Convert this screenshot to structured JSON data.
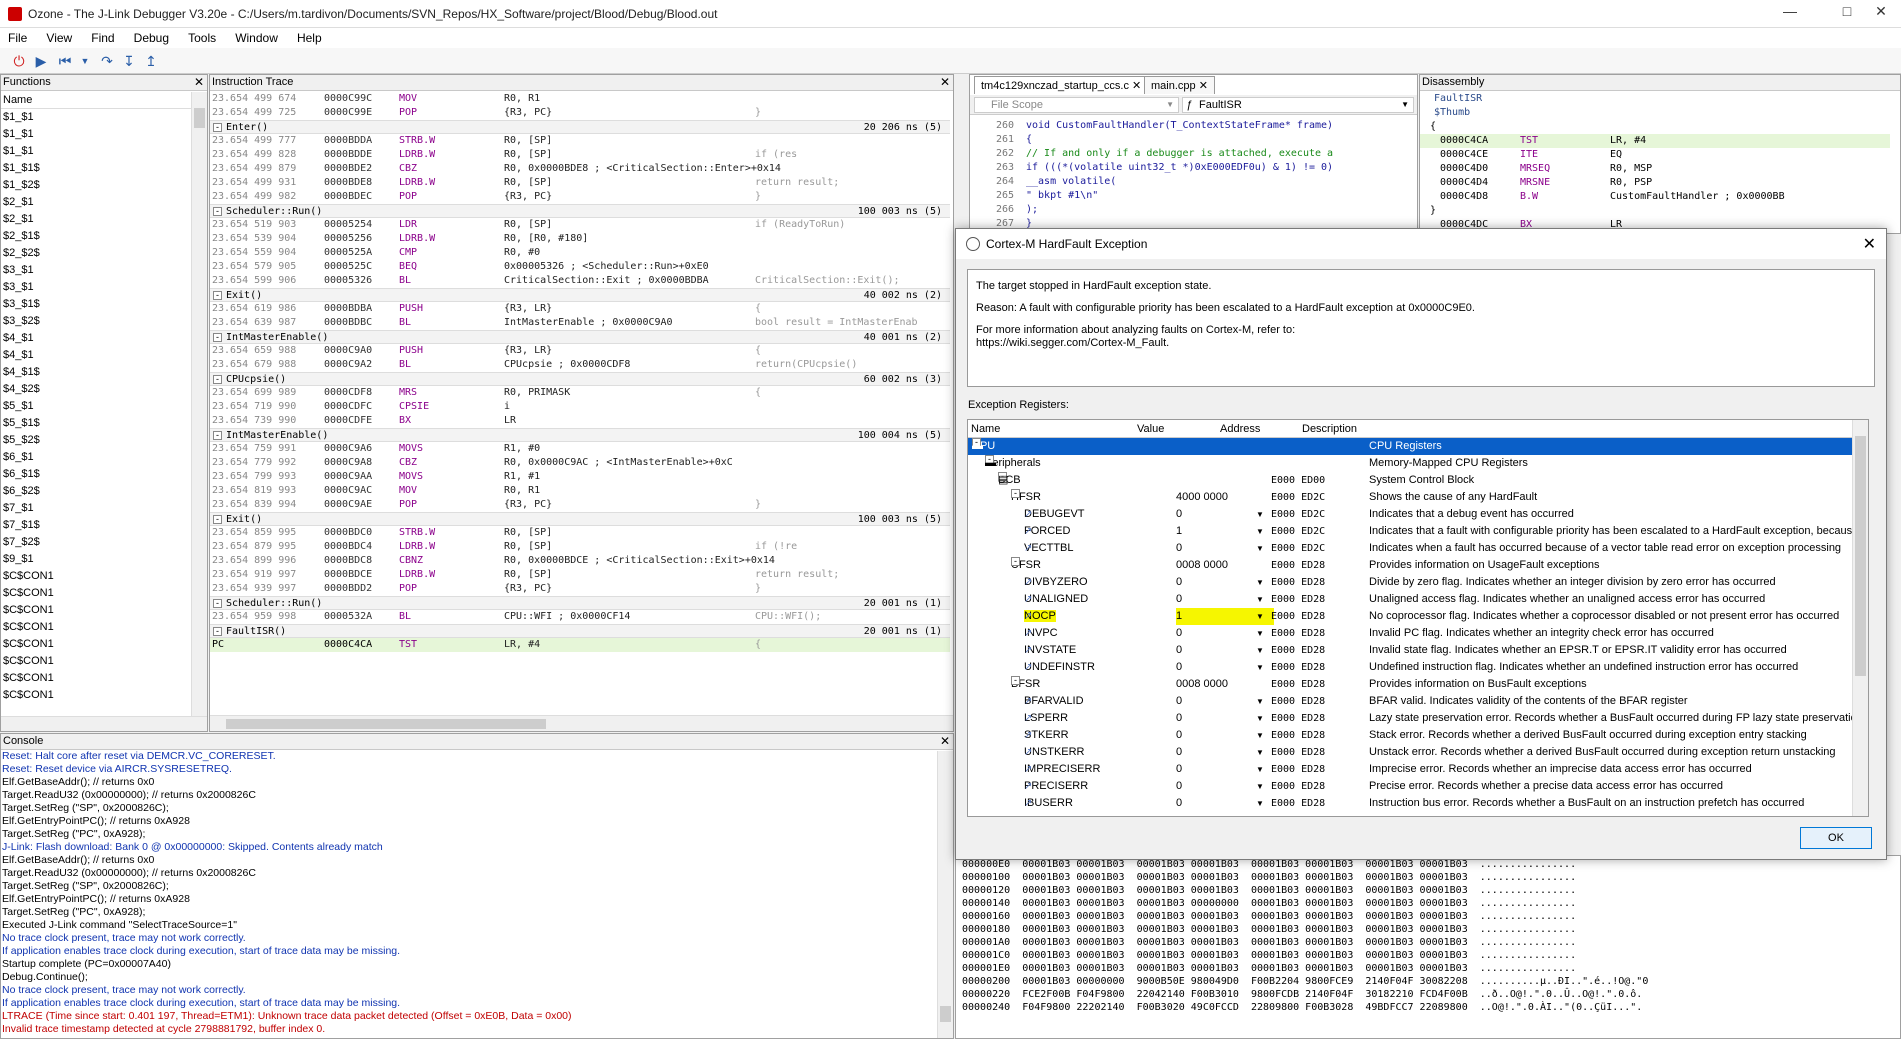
{
  "window": {
    "title": "Ozone - The J-Link Debugger V3.20e - C:/Users/m.tardivon/Documents/SVN_Repos/HX_Software/project/Blood/Debug/Blood.out"
  },
  "menu": [
    "File",
    "View",
    "Find",
    "Debug",
    "Tools",
    "Window",
    "Help"
  ],
  "functions": {
    "title": "Functions",
    "column": "Name",
    "items": [
      "$1_$1",
      "$1_$1",
      "$1_$1",
      "$1_$1$",
      "$1_$2$",
      "$2_$1",
      "$2_$1",
      "$2_$1$",
      "$2_$2$",
      "$3_$1",
      "$3_$1",
      "$3_$1$",
      "$3_$2$",
      "$4_$1",
      "$4_$1",
      "$4_$1$",
      "$4_$2$",
      "$5_$1",
      "$5_$1$",
      "$5_$2$",
      "$6_$1",
      "$6_$1$",
      "$6_$2$",
      "$7_$1",
      "$7_$1$",
      "$7_$2$",
      "$9_$1",
      "$C$CON1",
      "$C$CON1",
      "$C$CON1",
      "$C$CON1",
      "$C$CON1",
      "$C$CON1",
      "$C$CON1",
      "$C$CON1"
    ]
  },
  "trace": {
    "title": "Instruction Trace",
    "rows": [
      {
        "type": "ins",
        "ts": "23.654 499 674",
        "addr": "0000C99C",
        "mn": "MOV",
        "op": "R0, R1",
        "src": ""
      },
      {
        "type": "ins",
        "ts": "23.654 499 725",
        "addr": "0000C99E",
        "mn": "POP",
        "op": "{R3, PC}",
        "src": "}"
      },
      {
        "type": "hdr",
        "fn": "Enter()",
        "dur": "20 206 ns  (5)"
      },
      {
        "type": "ins",
        "ts": "23.654 499 777",
        "addr": "0000BDDA",
        "mn": "STRB.W",
        "op": "R0, [SP]",
        "src": ""
      },
      {
        "type": "ins",
        "ts": "23.654 499 828",
        "addr": "0000BDDE",
        "mn": "LDRB.W",
        "op": "R0, [SP]",
        "src": "if (res"
      },
      {
        "type": "ins",
        "ts": "23.654 499 879",
        "addr": "0000BDE2",
        "mn": "CBZ",
        "op": "R0, 0x0000BDE8 ; <CriticalSection::Enter>+0x14",
        "src": ""
      },
      {
        "type": "ins",
        "ts": "23.654 499 931",
        "addr": "0000BDE8",
        "mn": "LDRB.W",
        "op": "R0, [SP]",
        "src": "return result;"
      },
      {
        "type": "ins",
        "ts": "23.654 499 982",
        "addr": "0000BDEC",
        "mn": "POP",
        "op": "{R3, PC}",
        "src": "}"
      },
      {
        "type": "hdr",
        "fn": "Scheduler::Run()",
        "dur": "100 003 ns  (5)"
      },
      {
        "type": "ins",
        "ts": "23.654 519 903",
        "addr": "00005254",
        "mn": "LDR",
        "op": "R0, [SP]",
        "src": "if (ReadyToRun)"
      },
      {
        "type": "ins",
        "ts": "23.654 539 904",
        "addr": "00005256",
        "mn": "LDRB.W",
        "op": "R0, [R0, #180]",
        "src": ""
      },
      {
        "type": "ins",
        "ts": "23.654 559 904",
        "addr": "0000525A",
        "mn": "CMP",
        "op": "R0, #0",
        "src": ""
      },
      {
        "type": "ins",
        "ts": "23.654 579 905",
        "addr": "0000525C",
        "mn": "BEQ",
        "op": "0x00005326 ; <Scheduler::Run>+0xE0",
        "src": ""
      },
      {
        "type": "ins",
        "ts": "23.654 599 906",
        "addr": "00005326",
        "mn": "BL",
        "op": "CriticalSection::Exit ; 0x0000BDBA",
        "src": "CriticalSection::Exit();"
      },
      {
        "type": "hdr",
        "fn": "Exit()",
        "dur": "40 002 ns  (2)"
      },
      {
        "type": "ins",
        "ts": "23.654 619 986",
        "addr": "0000BDBA",
        "mn": "PUSH",
        "op": "{R3, LR}",
        "src": "{"
      },
      {
        "type": "ins",
        "ts": "23.654 639 987",
        "addr": "0000BDBC",
        "mn": "BL",
        "op": "IntMasterEnable ; 0x0000C9A0",
        "src": "bool result = IntMasterEnab"
      },
      {
        "type": "hdr",
        "fn": "IntMasterEnable()",
        "dur": "40 001 ns  (2)"
      },
      {
        "type": "ins",
        "ts": "23.654 659 988",
        "addr": "0000C9A0",
        "mn": "PUSH",
        "op": "{R3, LR}",
        "src": "{"
      },
      {
        "type": "ins",
        "ts": "23.654 679 988",
        "addr": "0000C9A2",
        "mn": "BL",
        "op": "CPUcpsie ; 0x0000CDF8",
        "src": "return(CPUcpsie()"
      },
      {
        "type": "hdr",
        "fn": "CPUcpsie()",
        "dur": "60 002 ns  (3)"
      },
      {
        "type": "ins",
        "ts": "23.654 699 989",
        "addr": "0000CDF8",
        "mn": "MRS",
        "op": "R0, PRIMASK",
        "src": "{"
      },
      {
        "type": "ins",
        "ts": "23.654 719 990",
        "addr": "0000CDFC",
        "mn": "CPSIE",
        "op": "i",
        "src": ""
      },
      {
        "type": "ins",
        "ts": "23.654 739 990",
        "addr": "0000CDFE",
        "mn": "BX",
        "op": "LR",
        "src": ""
      },
      {
        "type": "hdr",
        "fn": "IntMasterEnable()",
        "dur": "100 004 ns  (5)"
      },
      {
        "type": "ins",
        "ts": "23.654 759 991",
        "addr": "0000C9A6",
        "mn": "MOVS",
        "op": "R1, #0",
        "src": ""
      },
      {
        "type": "ins",
        "ts": "23.654 779 992",
        "addr": "0000C9A8",
        "mn": "CBZ",
        "op": "R0, 0x0000C9AC ; <IntMasterEnable>+0xC",
        "src": ""
      },
      {
        "type": "ins",
        "ts": "23.654 799 993",
        "addr": "0000C9AA",
        "mn": "MOVS",
        "op": "R1, #1",
        "src": ""
      },
      {
        "type": "ins",
        "ts": "23.654 819 993",
        "addr": "0000C9AC",
        "mn": "MOV",
        "op": "R0, R1",
        "src": ""
      },
      {
        "type": "ins",
        "ts": "23.654 839 994",
        "addr": "0000C9AE",
        "mn": "POP",
        "op": "{R3, PC}",
        "src": "}"
      },
      {
        "type": "hdr",
        "fn": "Exit()",
        "dur": "100 003 ns  (5)"
      },
      {
        "type": "ins",
        "ts": "23.654 859 995",
        "addr": "0000BDC0",
        "mn": "STRB.W",
        "op": "R0, [SP]",
        "src": ""
      },
      {
        "type": "ins",
        "ts": "23.654 879 995",
        "addr": "0000BDC4",
        "mn": "LDRB.W",
        "op": "R0, [SP]",
        "src": "if (!re"
      },
      {
        "type": "ins",
        "ts": "23.654 899 996",
        "addr": "0000BDC8",
        "mn": "CBNZ",
        "op": "R0, 0x0000BDCE ; <CriticalSection::Exit>+0x14",
        "src": ""
      },
      {
        "type": "ins",
        "ts": "23.654 919 997",
        "addr": "0000BDCE",
        "mn": "LDRB.W",
        "op": "R0, [SP]",
        "src": "return result;"
      },
      {
        "type": "ins",
        "ts": "23.654 939 997",
        "addr": "0000BDD2",
        "mn": "POP",
        "op": "{R3, PC}",
        "src": "}"
      },
      {
        "type": "hdr",
        "fn": "Scheduler::Run()",
        "dur": "20 001 ns  (1)"
      },
      {
        "type": "ins",
        "ts": "23.654 959 998",
        "addr": "0000532A",
        "mn": "BL",
        "op": "CPU::WFI ; 0x0000CF14",
        "src": "CPU::WFI();"
      },
      {
        "type": "hdr",
        "fn": "FaultISR()",
        "dur": "20 001 ns  (1)"
      },
      {
        "type": "pc",
        "ts": "PC",
        "addr": "0000C4CA",
        "mn": "TST",
        "op": "LR, #4",
        "src": "{"
      }
    ]
  },
  "console": {
    "title": "Console",
    "lines": [
      {
        "c": "blue",
        "t": "Reset: Halt core after reset via DEMCR.VC_CORERESET."
      },
      {
        "c": "blue",
        "t": "Reset: Reset device via AIRCR.SYSRESETREQ."
      },
      {
        "c": "black",
        "t": "Elf.GetBaseAddr(); // returns 0x0"
      },
      {
        "c": "black",
        "t": "Target.ReadU32 (0x00000000); // returns 0x2000826C"
      },
      {
        "c": "black",
        "t": "Target.SetReg (\"SP\", 0x2000826C);"
      },
      {
        "c": "black",
        "t": "Elf.GetEntryPointPC(); // returns 0xA928"
      },
      {
        "c": "black",
        "t": "Target.SetReg (\"PC\", 0xA928);"
      },
      {
        "c": "blue",
        "t": "J-Link: Flash download: Bank 0 @ 0x00000000: Skipped. Contents already match"
      },
      {
        "c": "black",
        "t": "Elf.GetBaseAddr(); // returns 0x0"
      },
      {
        "c": "black",
        "t": "Target.ReadU32 (0x00000000); // returns 0x2000826C"
      },
      {
        "c": "black",
        "t": "Target.SetReg (\"SP\", 0x2000826C);"
      },
      {
        "c": "black",
        "t": "Elf.GetEntryPointPC(); // returns 0xA928"
      },
      {
        "c": "black",
        "t": "Target.SetReg (\"PC\", 0xA928);"
      },
      {
        "c": "black",
        "t": "Executed J-Link command \"SelectTraceSource=1\""
      },
      {
        "c": "blue",
        "t": "No trace clock present, trace may not work correctly."
      },
      {
        "c": "blue",
        "t": "If application enables trace clock during execution, start of trace data may be missing."
      },
      {
        "c": "black",
        "t": "Startup complete (PC=0x00007A40)"
      },
      {
        "c": "black",
        "t": "Debug.Continue();"
      },
      {
        "c": "blue",
        "t": "No trace clock present, trace may not work correctly."
      },
      {
        "c": "blue",
        "t": "If application enables trace clock during execution, start of trace data may be missing."
      },
      {
        "c": "red",
        "t": "LTRACE (Time since start: 0.401 197, Thread=ETM1): Unknown trace data packet detected (Offset = 0xE0B, Data = 0x00)"
      },
      {
        "c": "red",
        "t": "Invalid trace timestamp detected at cycle 2798881792, buffer index 0."
      }
    ]
  },
  "source": {
    "tabs": [
      "tm4c129xnczad_startup_ccs.c",
      "main.cpp"
    ],
    "scope_file": "File Scope",
    "scope_func": "FaultISR",
    "lines": [
      {
        "no": "260",
        "code": "void CustomFaultHandler(T_ContextStateFrame* frame)"
      },
      {
        "no": "261",
        "code": "{"
      },
      {
        "no": "262",
        "code": "  // If and only if a debugger is attached, execute a"
      },
      {
        "no": "263",
        "code": "  if (((*(volatile uint32_t *)0xE000EDF0u) & 1) != 0)"
      },
      {
        "no": "264",
        "code": "    __asm volatile("
      },
      {
        "no": "265",
        "code": "      \"    bkpt #1\\n\""
      },
      {
        "no": "266",
        "code": "    );"
      },
      {
        "no": "267",
        "code": "  }"
      }
    ]
  },
  "disasm": {
    "title": "Disassembly",
    "lines": [
      {
        "a": "",
        "m": "FaultISR",
        "o": ""
      },
      {
        "a": "",
        "m": "$Thumb",
        "o": ""
      },
      {
        "a": "{",
        "m": "",
        "o": ""
      },
      {
        "a": "0000C4CA",
        "m": "TST",
        "o": "LR, #4"
      },
      {
        "a": "0000C4CE",
        "m": "ITE",
        "o": "EQ"
      },
      {
        "a": "0000C4D0",
        "m": "MRSEQ",
        "o": "R0, MSP"
      },
      {
        "a": "0000C4D4",
        "m": "MRSNE",
        "o": "R0, PSP"
      },
      {
        "a": "0000C4D8",
        "m": "B.W",
        "o": "CustomFaultHandler          ; 0x0000BB"
      },
      {
        "a": "}",
        "m": "",
        "o": ""
      },
      {
        "a": "0000C4DC",
        "m": "BX",
        "o": "LR"
      }
    ]
  },
  "memory": {
    "lines": [
      "000000E0  00001B03 00001B03  00001B03 00001B03  00001B03 00001B03  00001B03 00001B03  ................",
      "00000100  00001B03 00001B03  00001B03 00001B03  00001B03 00001B03  00001B03 00001B03  ................",
      "00000120  00001B03 00001B03  00001B03 00001B03  00001B03 00001B03  00001B03 00001B03  ................",
      "00000140  00001B03 00001B03  00001B03 00000000  00001B03 00001B03  00001B03 00001B03  ................",
      "00000160  00001B03 00001B03  00001B03 00001B03  00001B03 00001B03  00001B03 00001B03  ................",
      "00000180  00001B03 00001B03  00001B03 00001B03  00001B03 00001B03  00001B03 00001B03  ................",
      "000001A0  00001B03 00001B03  00001B03 00001B03  00001B03 00001B03  00001B03 00001B03  ................",
      "000001C0  00001B03 00001B03  00001B03 00001B03  00001B03 00001B03  00001B03 00001B03  ................",
      "000001E0  00001B03 00001B03  00001B03 00001B03  00001B03 00001B03  00001B03 00001B03  ................",
      "00000200  00001B03 00000000  9000B50E 980049D0  F00B2204 9800FCE9  2140F04F 30082208  ..........µ..ÐI..\".é..!O@.\"0",
      "00000220  FCE2F00B F04F9800  22042140 F00B3010  9800FCDB 2140F04F  30182210 FCD4F00B  ..ð..O@!.\".0..Û..O@!.\".0.ô.",
      "00000240  F04F9800 22202140  F00B3020 49C0FCCD  22809800 F00B3028  49BDFCC7 22089800  ..O@!.\".0.ÀI..\"(0..ÇüI...\"."
    ]
  },
  "dialog": {
    "title": "Cortex-M HardFault Exception",
    "msg1": "The target stopped in HardFault exception state.",
    "msg2": "Reason: A fault with configurable priority has been escalated to a HardFault exception at 0x0000C9E0.",
    "msg3": "For more information about analyzing faults on Cortex-M, refer to:",
    "msg4": "https://wiki.segger.com/Cortex-M_Fault.",
    "er_label": "Exception Registers:",
    "cols": [
      "Name",
      "Value",
      "Address",
      "Description"
    ],
    "ok": "OK",
    "rows": [
      {
        "lvl": 0,
        "tog": "-",
        "ic": "cpu",
        "name": "CPU",
        "val": "",
        "addr": "",
        "desc": "CPU Registers",
        "sel": true
      },
      {
        "lvl": 1,
        "tog": "-",
        "ic": "cpu",
        "name": "Peripherals",
        "val": "",
        "addr": "",
        "desc": "Memory-Mapped CPU Registers"
      },
      {
        "lvl": 2,
        "tog": "-",
        "ic": "blk",
        "name": "SCB",
        "val": "",
        "addr": "E000 ED00",
        "desc": "System Control Block"
      },
      {
        "lvl": 3,
        "tog": "-",
        "ic": "",
        "name": "HFSR",
        "val": "4000 0000",
        "addr": "E000 ED2C",
        "desc": "Shows the cause of any HardFault"
      },
      {
        "lvl": 4,
        "tog": "",
        "ic": "flag",
        "name": "DEBUGEVT",
        "val": "0",
        "dd": true,
        "addr": "E000 ED2C",
        "desc": "Indicates that a debug event has occurred"
      },
      {
        "lvl": 4,
        "tog": "",
        "ic": "flag",
        "name": "FORCED",
        "val": "1",
        "dd": true,
        "addr": "E000 ED2C",
        "desc": "Indicates that a fault with configurable priority has been escalated to a HardFault exception, because"
      },
      {
        "lvl": 4,
        "tog": "",
        "ic": "flag",
        "name": "VECTTBL",
        "val": "0",
        "dd": true,
        "addr": "E000 ED2C",
        "desc": "Indicates when a fault has occurred because of a vector table read error on exception processing"
      },
      {
        "lvl": 3,
        "tog": "-",
        "ic": "",
        "name": "UFSR",
        "val": "0008 0000",
        "addr": "E000 ED28",
        "desc": "Provides information on UsageFault exceptions"
      },
      {
        "lvl": 4,
        "tog": "",
        "ic": "flag",
        "name": "DIVBYZERO",
        "val": "0",
        "dd": true,
        "addr": "E000 ED28",
        "desc": "Divide by zero flag. Indicates whether an integer division by zero error has occurred"
      },
      {
        "lvl": 4,
        "tog": "",
        "ic": "flag",
        "name": "UNALIGNED",
        "val": "0",
        "dd": true,
        "addr": "E000 ED28",
        "desc": "Unaligned access flag. Indicates whether an unaligned access error has occurred"
      },
      {
        "lvl": 4,
        "tog": "",
        "ic": "flag",
        "name": "NOCP",
        "val": "1",
        "dd": true,
        "hl": true,
        "addr": "E000 ED28",
        "desc": "No coprocessor flag. Indicates whether a coprocessor disabled or not present error has occurred"
      },
      {
        "lvl": 4,
        "tog": "",
        "ic": "flag",
        "name": "INVPC",
        "val": "0",
        "dd": true,
        "addr": "E000 ED28",
        "desc": "Invalid PC flag. Indicates whether an integrity check error has occurred"
      },
      {
        "lvl": 4,
        "tog": "",
        "ic": "flag",
        "name": "INVSTATE",
        "val": "0",
        "dd": true,
        "addr": "E000 ED28",
        "desc": "Invalid state flag. Indicates whether an EPSR.T or EPSR.IT validity error has occurred"
      },
      {
        "lvl": 4,
        "tog": "",
        "ic": "flag",
        "name": "UNDEFINSTR",
        "val": "0",
        "dd": true,
        "addr": "E000 ED28",
        "desc": "Undefined instruction flag. Indicates whether an undefined instruction error has occurred"
      },
      {
        "lvl": 3,
        "tog": "-",
        "ic": "",
        "name": "BFSR",
        "val": "0008 0000",
        "addr": "E000 ED28",
        "desc": "Provides information on BusFault exceptions"
      },
      {
        "lvl": 4,
        "tog": "",
        "ic": "flag",
        "name": "BFARVALID",
        "val": "0",
        "dd": true,
        "addr": "E000 ED28",
        "desc": "BFAR valid. Indicates validity of the contents of the BFAR register"
      },
      {
        "lvl": 4,
        "tog": "",
        "ic": "flag",
        "name": "LSPERR",
        "val": "0",
        "dd": true,
        "addr": "E000 ED28",
        "desc": "Lazy state preservation error. Records whether a BusFault occurred during FP lazy state preservation"
      },
      {
        "lvl": 4,
        "tog": "",
        "ic": "flag",
        "name": "STKERR",
        "val": "0",
        "dd": true,
        "addr": "E000 ED28",
        "desc": "Stack error. Records whether a derived BusFault occurred during exception entry stacking"
      },
      {
        "lvl": 4,
        "tog": "",
        "ic": "flag",
        "name": "UNSTKERR",
        "val": "0",
        "dd": true,
        "addr": "E000 ED28",
        "desc": "Unstack error. Records whether a derived BusFault occurred during exception return unstacking"
      },
      {
        "lvl": 4,
        "tog": "",
        "ic": "flag",
        "name": "IMPRECISERR",
        "val": "0",
        "dd": true,
        "addr": "E000 ED28",
        "desc": "Imprecise error. Records whether an imprecise data access error has occurred"
      },
      {
        "lvl": 4,
        "tog": "",
        "ic": "flag",
        "name": "PRECISERR",
        "val": "0",
        "dd": true,
        "addr": "E000 ED28",
        "desc": "Precise error. Records whether a precise data access error has occurred"
      },
      {
        "lvl": 4,
        "tog": "",
        "ic": "flag",
        "name": "IBUSERR",
        "val": "0",
        "dd": true,
        "addr": "E000 ED28",
        "desc": "Instruction bus error. Records whether a BusFault on an instruction prefetch has occurred"
      }
    ]
  }
}
